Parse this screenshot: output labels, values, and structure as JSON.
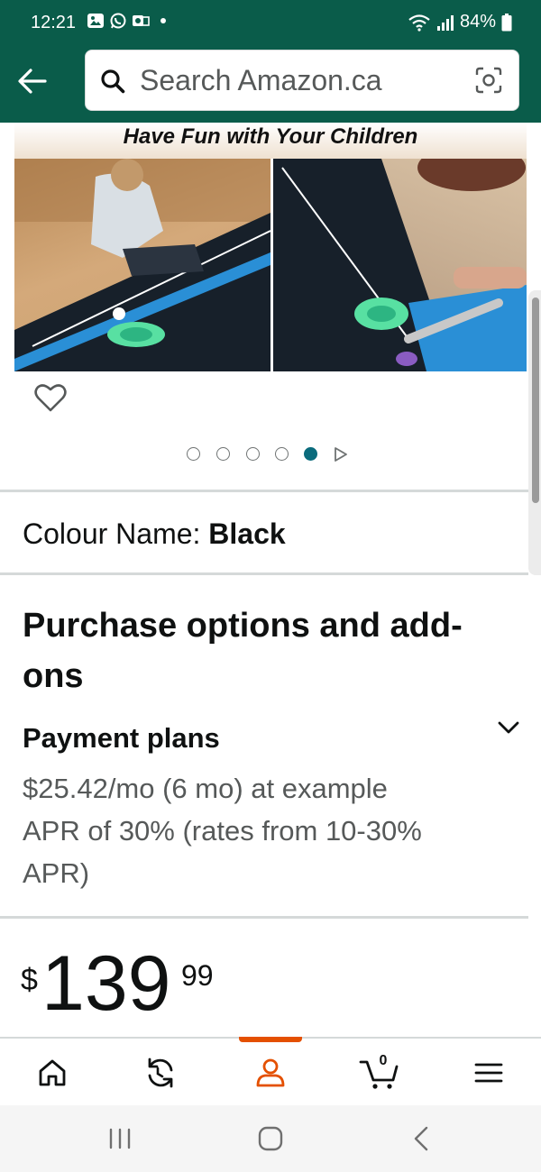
{
  "status_bar": {
    "time": "12:21",
    "battery": "84%"
  },
  "search": {
    "placeholder": "Search Amazon.ca"
  },
  "product_image": {
    "banner_text": "Have Fun with Your Children"
  },
  "carousel": {
    "dot_count": 5,
    "active_index": 4
  },
  "colour": {
    "label": "Colour Name: ",
    "value": "Black"
  },
  "purchase_options": {
    "title": "Purchase options and add-ons"
  },
  "payment_plans": {
    "title": "Payment plans",
    "description": "$25.42/mo (6 mo) at example APR of 30% (rates from 10-30% APR)"
  },
  "price": {
    "symbol": "$",
    "whole": "139",
    "fraction": "99"
  },
  "bottom_nav": {
    "cart_count": "0",
    "active_item": "account"
  },
  "colors": {
    "header_green": "#0a5c4a",
    "accent_orange": "#e45000",
    "active_dot": "#0a6b7c"
  }
}
